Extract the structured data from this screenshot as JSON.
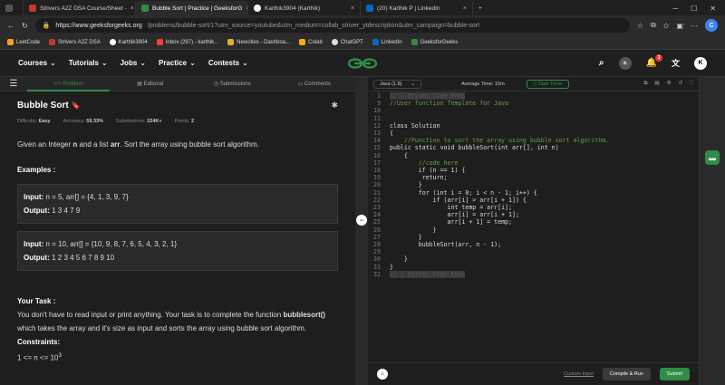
{
  "browser": {
    "tabs": [
      {
        "label": "Strivers A2Z DSA Course/Sheet - ",
        "favicon_color": "#c0392b",
        "active": false
      },
      {
        "label": "Bubble Sort | Practice | GeeksforG",
        "favicon_color": "#2f8d46",
        "active": true
      },
      {
        "label": "Karthik3904 (Karthik)",
        "favicon_color": "#ffffff",
        "active": false
      },
      {
        "label": "(20) Karthik P | LinkedIn",
        "favicon_color": "#0a66c2",
        "active": false
      }
    ],
    "url_host": "https://www.geeksforgeeks.org",
    "url_path": "/problems/bubble-sort/1?utm_source=youtube&utm_medium=collab_striver_ytdescription&utm_campaign=bubble-sort",
    "bookmarks": [
      {
        "label": "LeetCode",
        "color": "#f89f1b"
      },
      {
        "label": "Strivers A2Z DSA",
        "color": "#c0392b"
      },
      {
        "label": "Karthik3904",
        "color": "#ffffff"
      },
      {
        "label": "Inbox (297) - karthik...",
        "color": "#ea4335"
      },
      {
        "label": "Neocities - Dashboa...",
        "color": "#e1b12c"
      },
      {
        "label": "Colab",
        "color": "#f9ab00"
      },
      {
        "label": "ChatGPT",
        "color": "#dddddd"
      },
      {
        "label": "LinkedIn",
        "color": "#0a66c2"
      },
      {
        "label": "GeeksforGeeks",
        "color": "#2f8d46"
      }
    ]
  },
  "site": {
    "nav": [
      "Courses",
      "Tutorials",
      "Jobs",
      "Practice",
      "Contests"
    ],
    "logo_text": "GG",
    "notif_count": "3",
    "avatar_letter": "K",
    "brand_color": "#2f8d46"
  },
  "problem": {
    "tabs": [
      "Problem",
      "Editorial",
      "Submissions",
      "Comments"
    ],
    "title": "Bubble Sort",
    "difficulty_label": "Difficulty:",
    "difficulty": "Easy",
    "accuracy_label": "Accuracy:",
    "accuracy": "59.33%",
    "submissions_label": "Submissions:",
    "submissions": "224K+",
    "points_label": "Points:",
    "points": "2",
    "statement_pre": "Given an Integer ",
    "statement_n": "n",
    "statement_mid": " and a list ",
    "statement_arr": "arr",
    "statement_post": ". Sort the array using bubble sort algorithm.",
    "examples_heading": "Examples :",
    "examples": [
      {
        "input": "n = 5, arr[] = {4, 1, 3, 9, 7}",
        "output": "1 3 4 7 9"
      },
      {
        "input": "n = 10, arr[] = {10, 9, 8, 7, 6, 5, 4, 3, 2, 1}",
        "output": "1 2 3 4 5 6 7 8 9 10"
      }
    ],
    "input_label": "Input:",
    "output_label": "Output:",
    "task_heading": "Your Task :",
    "task_pre": "You don't have to read input or print anything. Your task is to complete the function ",
    "task_fn": "bubblesort()",
    "task_post": " which takes the array and it's size as input and sorts the array using bubble sort algorithm.",
    "constraints_heading": "Constraints:",
    "constraint_1": "1 <= n <= 10",
    "constraint_1_exp": "3"
  },
  "editor": {
    "language": "Java (1.8)",
    "avg_time": "Average Time: 15m",
    "timer_label": "Start Timer",
    "custom_input": "Custom Input",
    "run_label": "Compile & Run",
    "submit_label": "Submit",
    "lines": [
      {
        "n": "1",
        "text": "// } Driver Code Ends",
        "cls": "hidden"
      },
      {
        "n": "9",
        "text": "//User function Template for Java",
        "cls": "cm"
      },
      {
        "n": "10",
        "text": "",
        "cls": "pl"
      },
      {
        "n": "11",
        "text": "",
        "cls": "pl"
      },
      {
        "n": "12",
        "text": "class Solution",
        "cls": "pl"
      },
      {
        "n": "13",
        "text": "{",
        "cls": "pl"
      },
      {
        "n": "14",
        "text": "    //Function to sort the array using bubble sort algorithm.",
        "cls": "cm"
      },
      {
        "n": "15",
        "text": "public static void bubbleSort(int arr[], int n)",
        "cls": "pl"
      },
      {
        "n": "16",
        "text": "    {",
        "cls": "pl"
      },
      {
        "n": "17",
        "text": "        //code here",
        "cls": "cm"
      },
      {
        "n": "18",
        "text": "        if (n == 1) {",
        "cls": "pl"
      },
      {
        "n": "19",
        "text": "         return;",
        "cls": "pl"
      },
      {
        "n": "20",
        "text": "        }",
        "cls": "pl"
      },
      {
        "n": "21",
        "text": "        for (int i = 0; i < n - 1; i++) {",
        "cls": "pl"
      },
      {
        "n": "22",
        "text": "            if (arr[i] > arr[i + 1]) {",
        "cls": "pl"
      },
      {
        "n": "23",
        "text": "                int temp = arr[i];",
        "cls": "pl"
      },
      {
        "n": "24",
        "text": "                arr[i] = arr[i + 1];",
        "cls": "pl"
      },
      {
        "n": "25",
        "text": "                arr[i + 1] = temp;",
        "cls": "pl"
      },
      {
        "n": "26",
        "text": "            }",
        "cls": "pl"
      },
      {
        "n": "27",
        "text": "        }",
        "cls": "pl"
      },
      {
        "n": "28",
        "text": "        bubbleSort(arr, n - 1);",
        "cls": "pl"
      },
      {
        "n": "29",
        "text": "",
        "cls": "pl"
      },
      {
        "n": "30",
        "text": "    }",
        "cls": "pl"
      },
      {
        "n": "31",
        "text": "}",
        "cls": "pl"
      },
      {
        "n": "32",
        "text": "// } Driver Code Ends",
        "cls": "hidden"
      }
    ]
  }
}
